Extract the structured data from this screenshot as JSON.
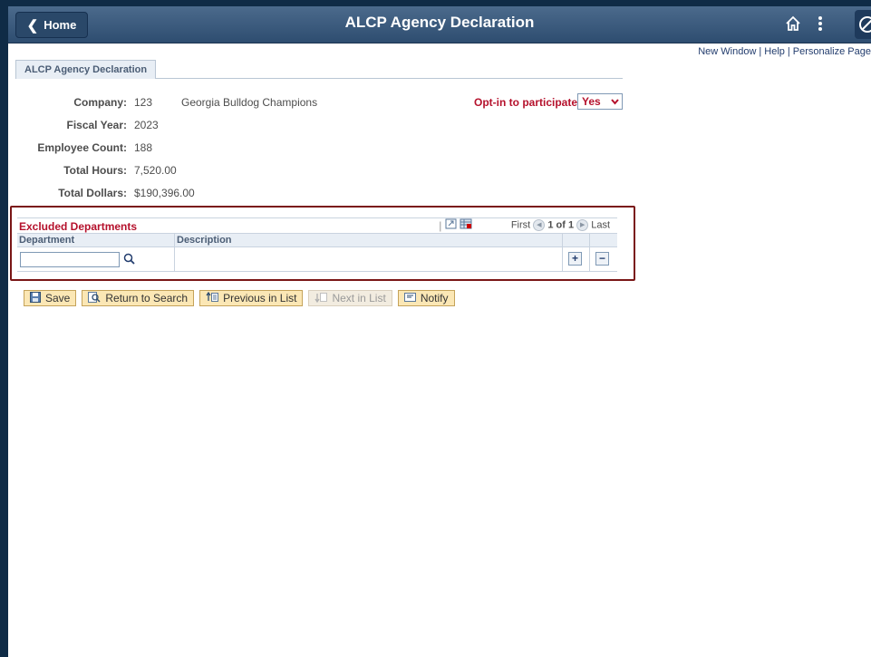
{
  "header": {
    "home_label": "Home",
    "title": "ALCP Agency Declaration",
    "icons": [
      "home-icon",
      "more-vertical-icon",
      "navbar-icon"
    ]
  },
  "top_links": {
    "new_window": "New Window",
    "help": "Help",
    "personalize": "Personalize Page",
    "separator": "|"
  },
  "tab": {
    "label": "ALCP Agency Declaration"
  },
  "fields": {
    "company_label": "Company:",
    "company_value": "123",
    "company_desc": "Georgia Bulldog Champions",
    "fiscal_year_label": "Fiscal Year:",
    "fiscal_year_value": "2023",
    "employee_count_label": "Employee Count:",
    "employee_count_value": "188",
    "total_hours_label": "Total Hours:",
    "total_hours_value": "7,520.00",
    "total_dollars_label": "Total Dollars:",
    "total_dollars_value": "$190,396.00",
    "optin_label": "Opt-in to participate:",
    "optin_value": "Yes"
  },
  "grid": {
    "title": "Excluded Departments",
    "nav_first": "First",
    "nav_page": "1 of 1",
    "nav_last": "Last",
    "columns": [
      "Department",
      "Description"
    ],
    "rows": [
      {
        "department": "",
        "description": ""
      }
    ],
    "add_row": "+",
    "delete_row": "−"
  },
  "toolbar": {
    "save": "Save",
    "return_to_search": "Return to Search",
    "previous_in_list": "Previous in List",
    "next_in_list": "Next in List",
    "notify": "Notify"
  },
  "colors": {
    "banner": "#2e4d70",
    "required_label": "#b5112c",
    "highlight_border": "#7a1616",
    "button_bg": "#fbe7b5"
  }
}
